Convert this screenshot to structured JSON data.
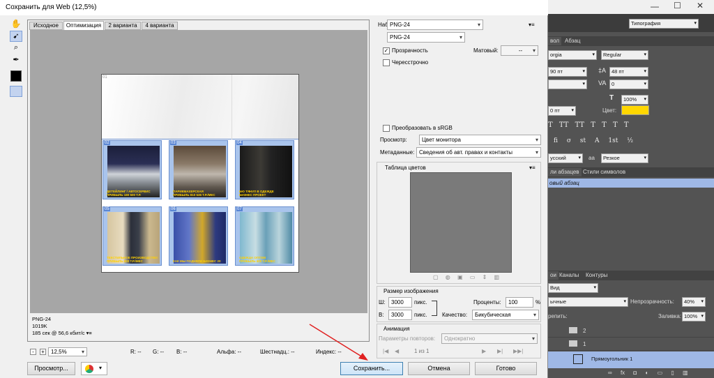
{
  "ps": {
    "workspace": "Типография",
    "char_tabs": [
      "вол",
      "Абзац"
    ],
    "font_family": "orgia",
    "font_style": "Regular",
    "font_size": "90 пт",
    "leading": "48 пт",
    "tracking": "0",
    "vscale": "100%",
    "baseline": "0 пт",
    "color_label": "Цвет:",
    "color_swatch": "#ffd700",
    "typo_buttons": [
      "T",
      "TT",
      "TT",
      "T",
      "T",
      "T",
      "T",
      "T",
      "fi",
      "σ",
      "st",
      "A",
      "ad",
      "T",
      "1st",
      "½"
    ],
    "lang": "усский",
    "aa_icon": "aa",
    "aa_mode": "Резкое",
    "style_tabs": [
      "ли абзацев",
      "Стили символов"
    ],
    "style_item": "овый абзац",
    "layer_tabs": [
      "ои",
      "Каналы",
      "Контуры"
    ],
    "layer_kind": "Вид",
    "blend_mode": "ычные",
    "opacity_label": "Непрозрачность:",
    "opacity": "40%",
    "lock_label": "репить:",
    "fill_label": "Заливка:",
    "fill": "100%",
    "layers": [
      {
        "name": "2"
      },
      {
        "name": "1"
      },
      {
        "name": "Прямоугольник 1"
      }
    ],
    "footer_icons": [
      "link-icon",
      "fx-icon",
      "mask-icon",
      "adjust-icon",
      "folder-icon",
      "new-layer-icon",
      "trash-icon"
    ]
  },
  "dialog": {
    "title": "Сохранить для Web (12,5%)",
    "tabs": [
      "Исходное",
      "Оптимизация",
      "2 варианта",
      "4 варианта"
    ],
    "tools": [
      "hand-icon",
      "slice-select-icon",
      "zoom-icon",
      "eyedropper-icon",
      "color-swatch",
      "toggle-slices-icon"
    ],
    "info": {
      "format": "PNG-24",
      "size": "1019K",
      "time": "185 сек @ 56,6 кбит/с"
    },
    "status": {
      "zoom": "12,5%",
      "r": "R: --",
      "g": "G: --",
      "b": "B: --",
      "alpha": "Альфа: --",
      "hex": "Шестнадц.: --",
      "index": "Индекс: --"
    },
    "slices": [
      {
        "num": "02",
        "cap1": "ДЕТЕЙЛИНГ / АВТОСЕРВИС",
        "cap2": "ПРИБЫЛЬ 180 500 Т.Р."
      },
      {
        "num": "03",
        "cap1": "ПАРИКМАХЕРСКАЯ",
        "cap2": "ПРИБЫЛЬ 810 536 Т.Р./МЕС"
      },
      {
        "num": "04",
        "cap1": "БЮ ТЯНУЛ В ОДЕЖДЕ",
        "cap2": "БИЗНЕС ПРОЕКТ"
      },
      {
        "num": "05",
        "cap1": "ТЕКСТИЛЬНОЕ ПРОИЗВОДСТВО",
        "cap2": "ПРИБЫЛЬ 600 Т.Р./МЕС"
      },
      {
        "num": "06",
        "cap1": "КАК МЫ ПОДНЯЛИ БИЗНЕС 20",
        "cap2": ""
      },
      {
        "num": "07",
        "cap1": "ОДЕЖДА ОПТОМ",
        "cap2": "ПРИБЫЛЬ 400 Т.Р./МЕС"
      }
    ],
    "first_slice": "01",
    "settings": {
      "preset_label": "Набор:",
      "preset": "PNG-24",
      "format": "PNG-24",
      "transparency": "Прозрачность",
      "matte_label": "Матовый:",
      "matte": "--",
      "interlaced": "Чересстрочно",
      "convert_srgb": "Преобразовать в sRGB",
      "preview_label": "Просмотр:",
      "preview": "Цвет монитора",
      "metadata_label": "Метаданные:",
      "metadata": "Сведения об авт. правах и контакты",
      "color_table": "Таблица цветов",
      "image_size": "Размер изображения",
      "w_label": "Ш:",
      "w": "3000",
      "h_label": "В:",
      "h": "3000",
      "unit": "пикс.",
      "percent_label": "Проценты:",
      "percent": "100",
      "percent_unit": "%",
      "quality_label": "Качество:",
      "quality": "Бикубическая",
      "animation": "Анимация",
      "loop_label": "Параметры повторов:",
      "loop": "Однократно",
      "frame": "1 из 1"
    },
    "buttons": {
      "preview": "Просмотр...",
      "save": "Сохранить...",
      "cancel": "Отмена",
      "done": "Готово"
    }
  }
}
